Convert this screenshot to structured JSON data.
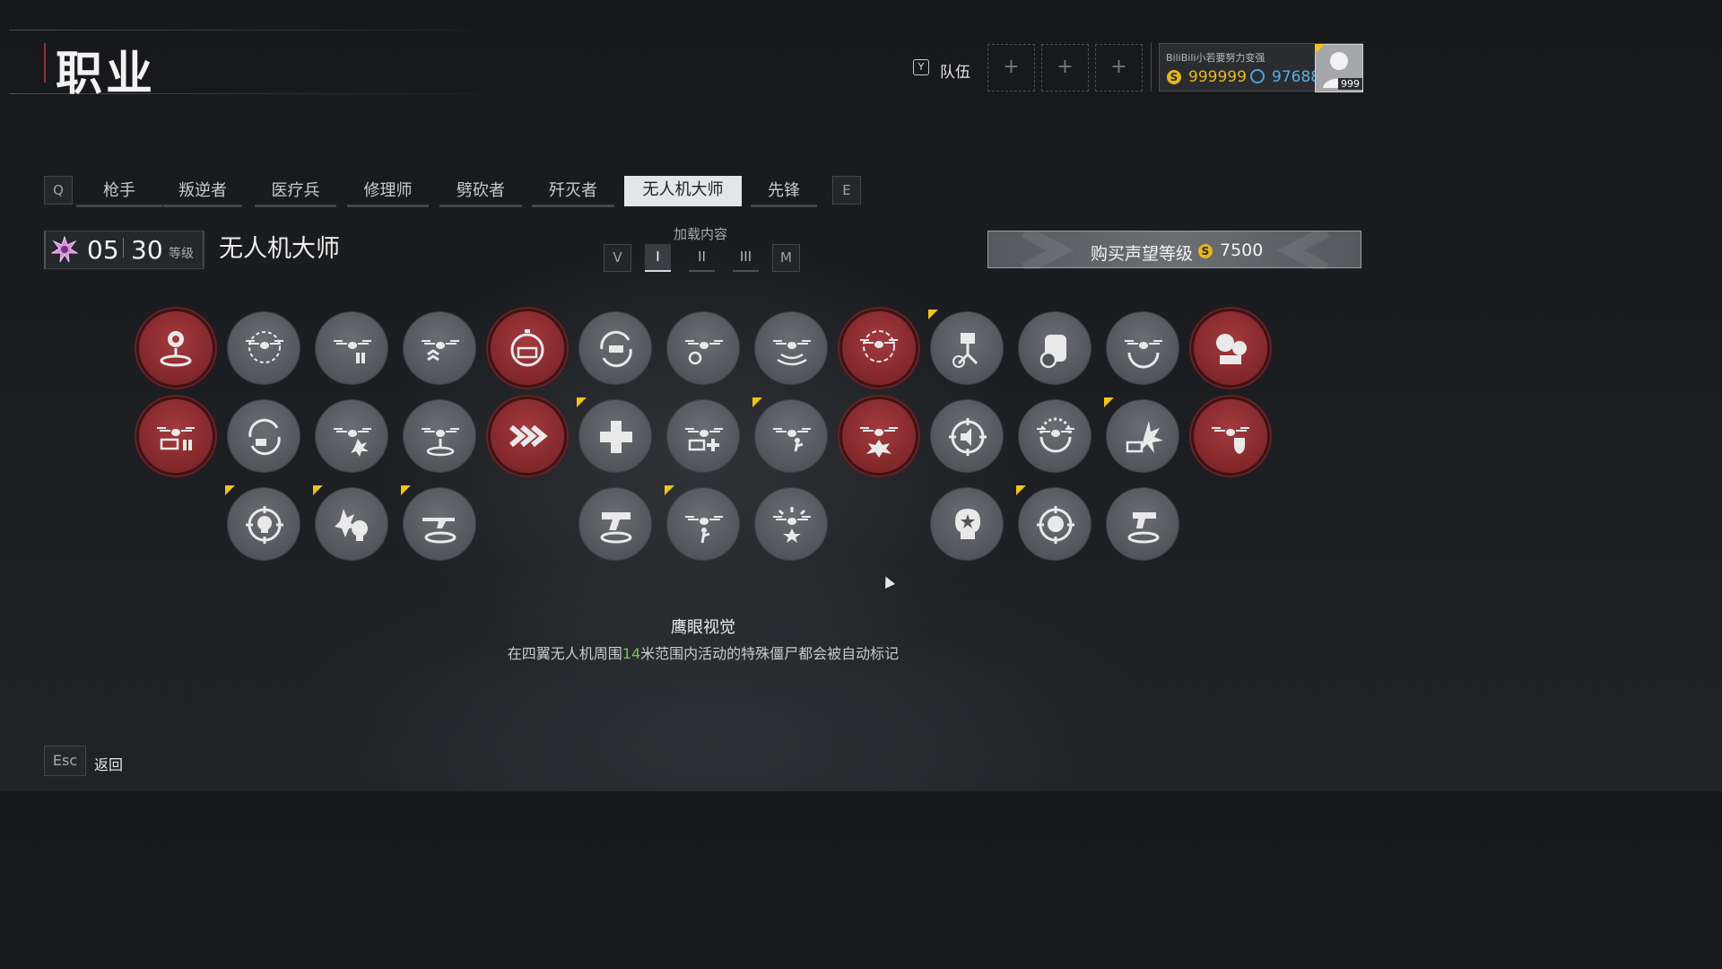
{
  "header": {
    "title": "职业",
    "team_key": "Y",
    "team_label": "队伍",
    "slot_symbol": "+"
  },
  "profile": {
    "name": "BiliBili小若要努力变强",
    "gold_symbol": "S",
    "gold": "999999",
    "gems": "97688",
    "level": "999"
  },
  "tabs": {
    "prev_key": "Q",
    "next_key": "E",
    "items": [
      "枪手",
      "叛逆者",
      "医疗兵",
      "修理师",
      "劈砍者",
      "歼灭者",
      "无人机大师",
      "先锋"
    ],
    "active_index": 6
  },
  "class_info": {
    "rank": "05",
    "level": "30",
    "level_word": "等级",
    "name": "无人机大师"
  },
  "loadout": {
    "label": "加载内容",
    "buttons": [
      "V",
      "I",
      "II",
      "III",
      "M"
    ],
    "active": "I"
  },
  "buy": {
    "label": "购买声望等级",
    "price_symbol": "S",
    "price": "7500"
  },
  "skills": [
    {
      "icon": "drone-location-icon",
      "state": "active",
      "new": false
    },
    {
      "icon": "drone-target-icon",
      "state": "locked",
      "new": false
    },
    {
      "icon": "drone-ammo-icon",
      "state": "locked",
      "new": false
    },
    {
      "icon": "drone-rank-icon",
      "state": "locked",
      "new": false
    },
    {
      "icon": "battery-timer-icon",
      "state": "active",
      "new": false
    },
    {
      "icon": "rotate-repair-icon",
      "state": "locked",
      "new": false
    },
    {
      "icon": "drone-cooldown-icon",
      "state": "locked",
      "new": false
    },
    {
      "icon": "drone-signal-icon",
      "state": "locked",
      "new": false
    },
    {
      "icon": "drone-scan-icon",
      "state": "active",
      "new": false
    },
    {
      "icon": "turret-check-icon",
      "state": "locked",
      "new": true
    },
    {
      "icon": "backpack-timer-icon",
      "state": "locked",
      "new": false
    },
    {
      "icon": "drone-reload-icon",
      "state": "locked",
      "new": false
    },
    {
      "icon": "skull-equipment-icon",
      "state": "active",
      "new": false
    },
    {
      "icon": "drone-battery-ammo-icon",
      "state": "active",
      "new": false
    },
    {
      "icon": "battery-reload-icon",
      "state": "locked",
      "new": false
    },
    {
      "icon": "drone-explosion-icon",
      "state": "locked",
      "new": false
    },
    {
      "icon": "drone-landing-icon",
      "state": "locked",
      "new": false
    },
    {
      "icon": "speed-chevrons-icon",
      "state": "active",
      "new": false
    },
    {
      "icon": "medical-cross-icon",
      "state": "locked",
      "new": true
    },
    {
      "icon": "drone-heal-battery-icon",
      "state": "locked",
      "new": false
    },
    {
      "icon": "drone-soldier-icon",
      "state": "locked",
      "new": true
    },
    {
      "icon": "drone-blast-icon",
      "state": "active",
      "new": false
    },
    {
      "icon": "target-speaker-icon",
      "state": "locked",
      "new": false
    },
    {
      "icon": "drone-rotate-icon",
      "state": "locked",
      "new": false
    },
    {
      "icon": "battery-blast-icon",
      "state": "locked",
      "new": true
    },
    {
      "icon": "drone-shield-icon",
      "state": "active",
      "new": false
    },
    {
      "icon": "skull-target-icon",
      "state": "locked",
      "new": true
    },
    {
      "icon": "skull-explosion-icon",
      "state": "locked",
      "new": true
    },
    {
      "icon": "rifle-landing-icon",
      "state": "locked",
      "new": true
    },
    {
      "icon": "smg-landing-icon",
      "state": "locked",
      "new": false
    },
    {
      "icon": "drone-soldier-alt-icon",
      "state": "locked",
      "new": true
    },
    {
      "icon": "drone-burst-icon",
      "state": "locked",
      "new": false
    },
    {
      "icon": "skull-star-icon",
      "state": "locked",
      "new": false
    },
    {
      "icon": "target-skull-star-icon",
      "state": "locked",
      "new": true
    },
    {
      "icon": "pistol-landing-icon",
      "state": "locked",
      "new": false
    }
  ],
  "description": {
    "title": "鹰眼视觉",
    "text_pre": "在四翼无人机周围",
    "text_num": "14",
    "text_post": "米范围内活动的特殊僵尸都会被自动标记"
  },
  "footer": {
    "esc_key": "Esc",
    "back_label": "返回"
  }
}
